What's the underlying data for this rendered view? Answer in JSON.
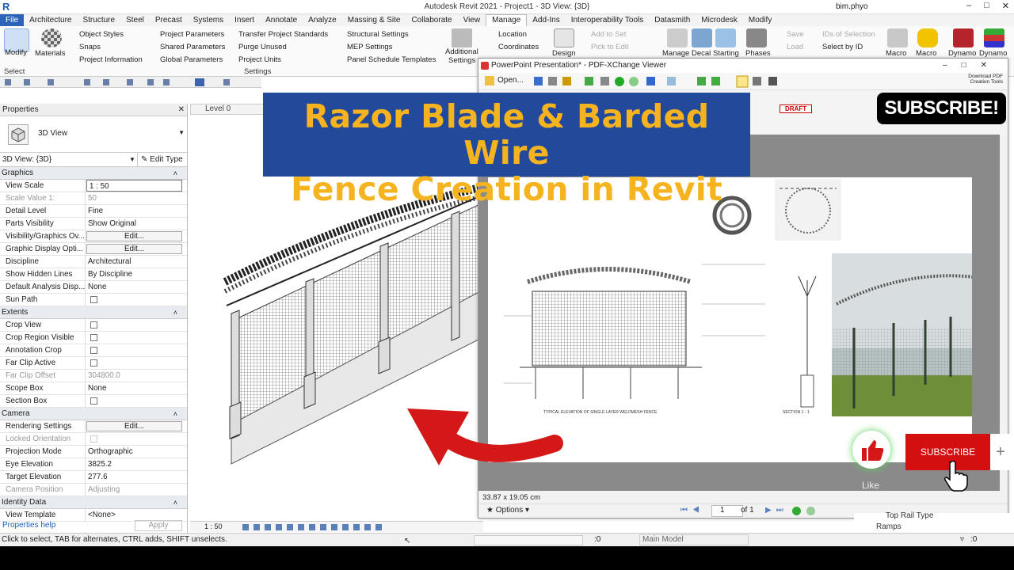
{
  "window": {
    "title": "Autodesk Revit 2021 - Project1 - 3D View: {3D}",
    "user": "bim.phyo"
  },
  "menu": [
    "File",
    "Architecture",
    "Structure",
    "Steel",
    "Precast",
    "Systems",
    "Insert",
    "Annotate",
    "Analyze",
    "Massing & Site",
    "Collaborate",
    "View",
    "Manage",
    "Add-Ins",
    "Interoperability Tools",
    "Datasmith",
    "Microdesk",
    "Modify"
  ],
  "ribbon": {
    "modify": "Modify",
    "materials": "Materials",
    "object_styles": "Object  Styles",
    "snaps": "Snaps",
    "project_information": "Project  Information",
    "project_parameters": "Project  Parameters",
    "shared_parameters": "Shared  Parameters",
    "global_parameters": "Global  Parameters",
    "transfer_standards": "Transfer  Project Standards",
    "purge_unused": "Purge  Unused",
    "project_units": "Project  Units",
    "structural_settings": "Structural  Settings",
    "mep_settings": "MEP  Settings",
    "panel_schedule_templates": "Panel Schedule  Templates",
    "additional_settings_1": "Additional",
    "additional_settings_2": "Settings",
    "location": "Location",
    "coordinates": "Coordinates",
    "design": "Design",
    "add_to_set": "Add to Set",
    "pick_to_edit": "Pick to Edit",
    "manage": "Manage",
    "decal": "Decal",
    "starting": "Starting",
    "phases": "Phases",
    "save": "Save",
    "load": "Load",
    "ids_of_selection": "IDs of  Selection",
    "select_by_id": "Select  by ID",
    "macro1": "Macro",
    "macro2": "Macro",
    "dynamo1": "Dynamo",
    "dynamo2": "Dynamo",
    "select_label": "Select",
    "settings_label": "Settings"
  },
  "properties": {
    "header": "Properties",
    "type": "3D View",
    "selector": "3D View: {3D}",
    "edit_type": "Edit Type",
    "sections": [
      {
        "name": "Graphics",
        "rows": [
          {
            "k": "View Scale",
            "v": "1 : 50",
            "kind": "input"
          },
          {
            "k": "Scale Value    1:",
            "v": "50",
            "kind": "dim"
          },
          {
            "k": "Detail Level",
            "v": "Fine",
            "kind": "text"
          },
          {
            "k": "Parts Visibility",
            "v": "Show Original",
            "kind": "text"
          },
          {
            "k": "Visibility/Graphics Ov...",
            "v": "Edit...",
            "kind": "button"
          },
          {
            "k": "Graphic Display Opti...",
            "v": "Edit...",
            "kind": "button"
          },
          {
            "k": "Discipline",
            "v": "Architectural",
            "kind": "text"
          },
          {
            "k": "Show Hidden Lines",
            "v": "By Discipline",
            "kind": "text"
          },
          {
            "k": "Default Analysis Disp...",
            "v": "None",
            "kind": "text"
          },
          {
            "k": "Sun Path",
            "v": "",
            "kind": "check"
          }
        ]
      },
      {
        "name": "Extents",
        "rows": [
          {
            "k": "Crop View",
            "v": "",
            "kind": "check"
          },
          {
            "k": "Crop Region Visible",
            "v": "",
            "kind": "check"
          },
          {
            "k": "Annotation Crop",
            "v": "",
            "kind": "check"
          },
          {
            "k": "Far Clip Active",
            "v": "",
            "kind": "check"
          },
          {
            "k": "Far Clip Offset",
            "v": "304800.0",
            "kind": "dim"
          },
          {
            "k": "Scope Box",
            "v": "None",
            "kind": "text"
          },
          {
            "k": "Section Box",
            "v": "",
            "kind": "check"
          }
        ]
      },
      {
        "name": "Camera",
        "rows": [
          {
            "k": "Rendering Settings",
            "v": "Edit...",
            "kind": "button"
          },
          {
            "k": "Locked Orientation",
            "v": "",
            "kind": "dimcheck"
          },
          {
            "k": "Projection Mode",
            "v": "Orthographic",
            "kind": "text"
          },
          {
            "k": "Eye Elevation",
            "v": "3825.2",
            "kind": "text"
          },
          {
            "k": "Target Elevation",
            "v": "277.6",
            "kind": "text"
          },
          {
            "k": "Camera Position",
            "v": "Adjusting",
            "kind": "dim"
          }
        ]
      },
      {
        "name": "Identity Data",
        "rows": [
          {
            "k": "View Template",
            "v": "<None>",
            "kind": "text"
          }
        ]
      }
    ],
    "help": "Properties help",
    "apply": "Apply"
  },
  "view": {
    "tab": "Level 0",
    "scale": "1 : 50"
  },
  "status": {
    "hint": "Click to select, TAB for alternates, CTRL adds, SHIFT unselects.",
    "coord": ":0",
    "model": "Main Model"
  },
  "banner": {
    "line1": "Razor Blade & Barded Wire",
    "line2": "Fence Creation in Revit"
  },
  "pdf": {
    "title": "PowerPoint Presentation* - PDF-XChange Viewer",
    "open": "Open...",
    "draft": "DRAFT",
    "download": "Download PDF Creation Tools",
    "size": "33.87 x 19.05 cm",
    "options": "Options",
    "page": "1",
    "of": "of 1",
    "caption1": "TYPICAL ELEVATION OF SINGLE LAYER WELDMESH FENCE",
    "caption2": "SECTION 1 - 1"
  },
  "overlay": {
    "subscribe_badge": "SUBSCRIBE!",
    "subscribe_button": "SUBSCRIBE",
    "plus": "+",
    "like": "Like"
  },
  "browser": {
    "item1": "Top Rail Type",
    "item2": "Ramps"
  }
}
